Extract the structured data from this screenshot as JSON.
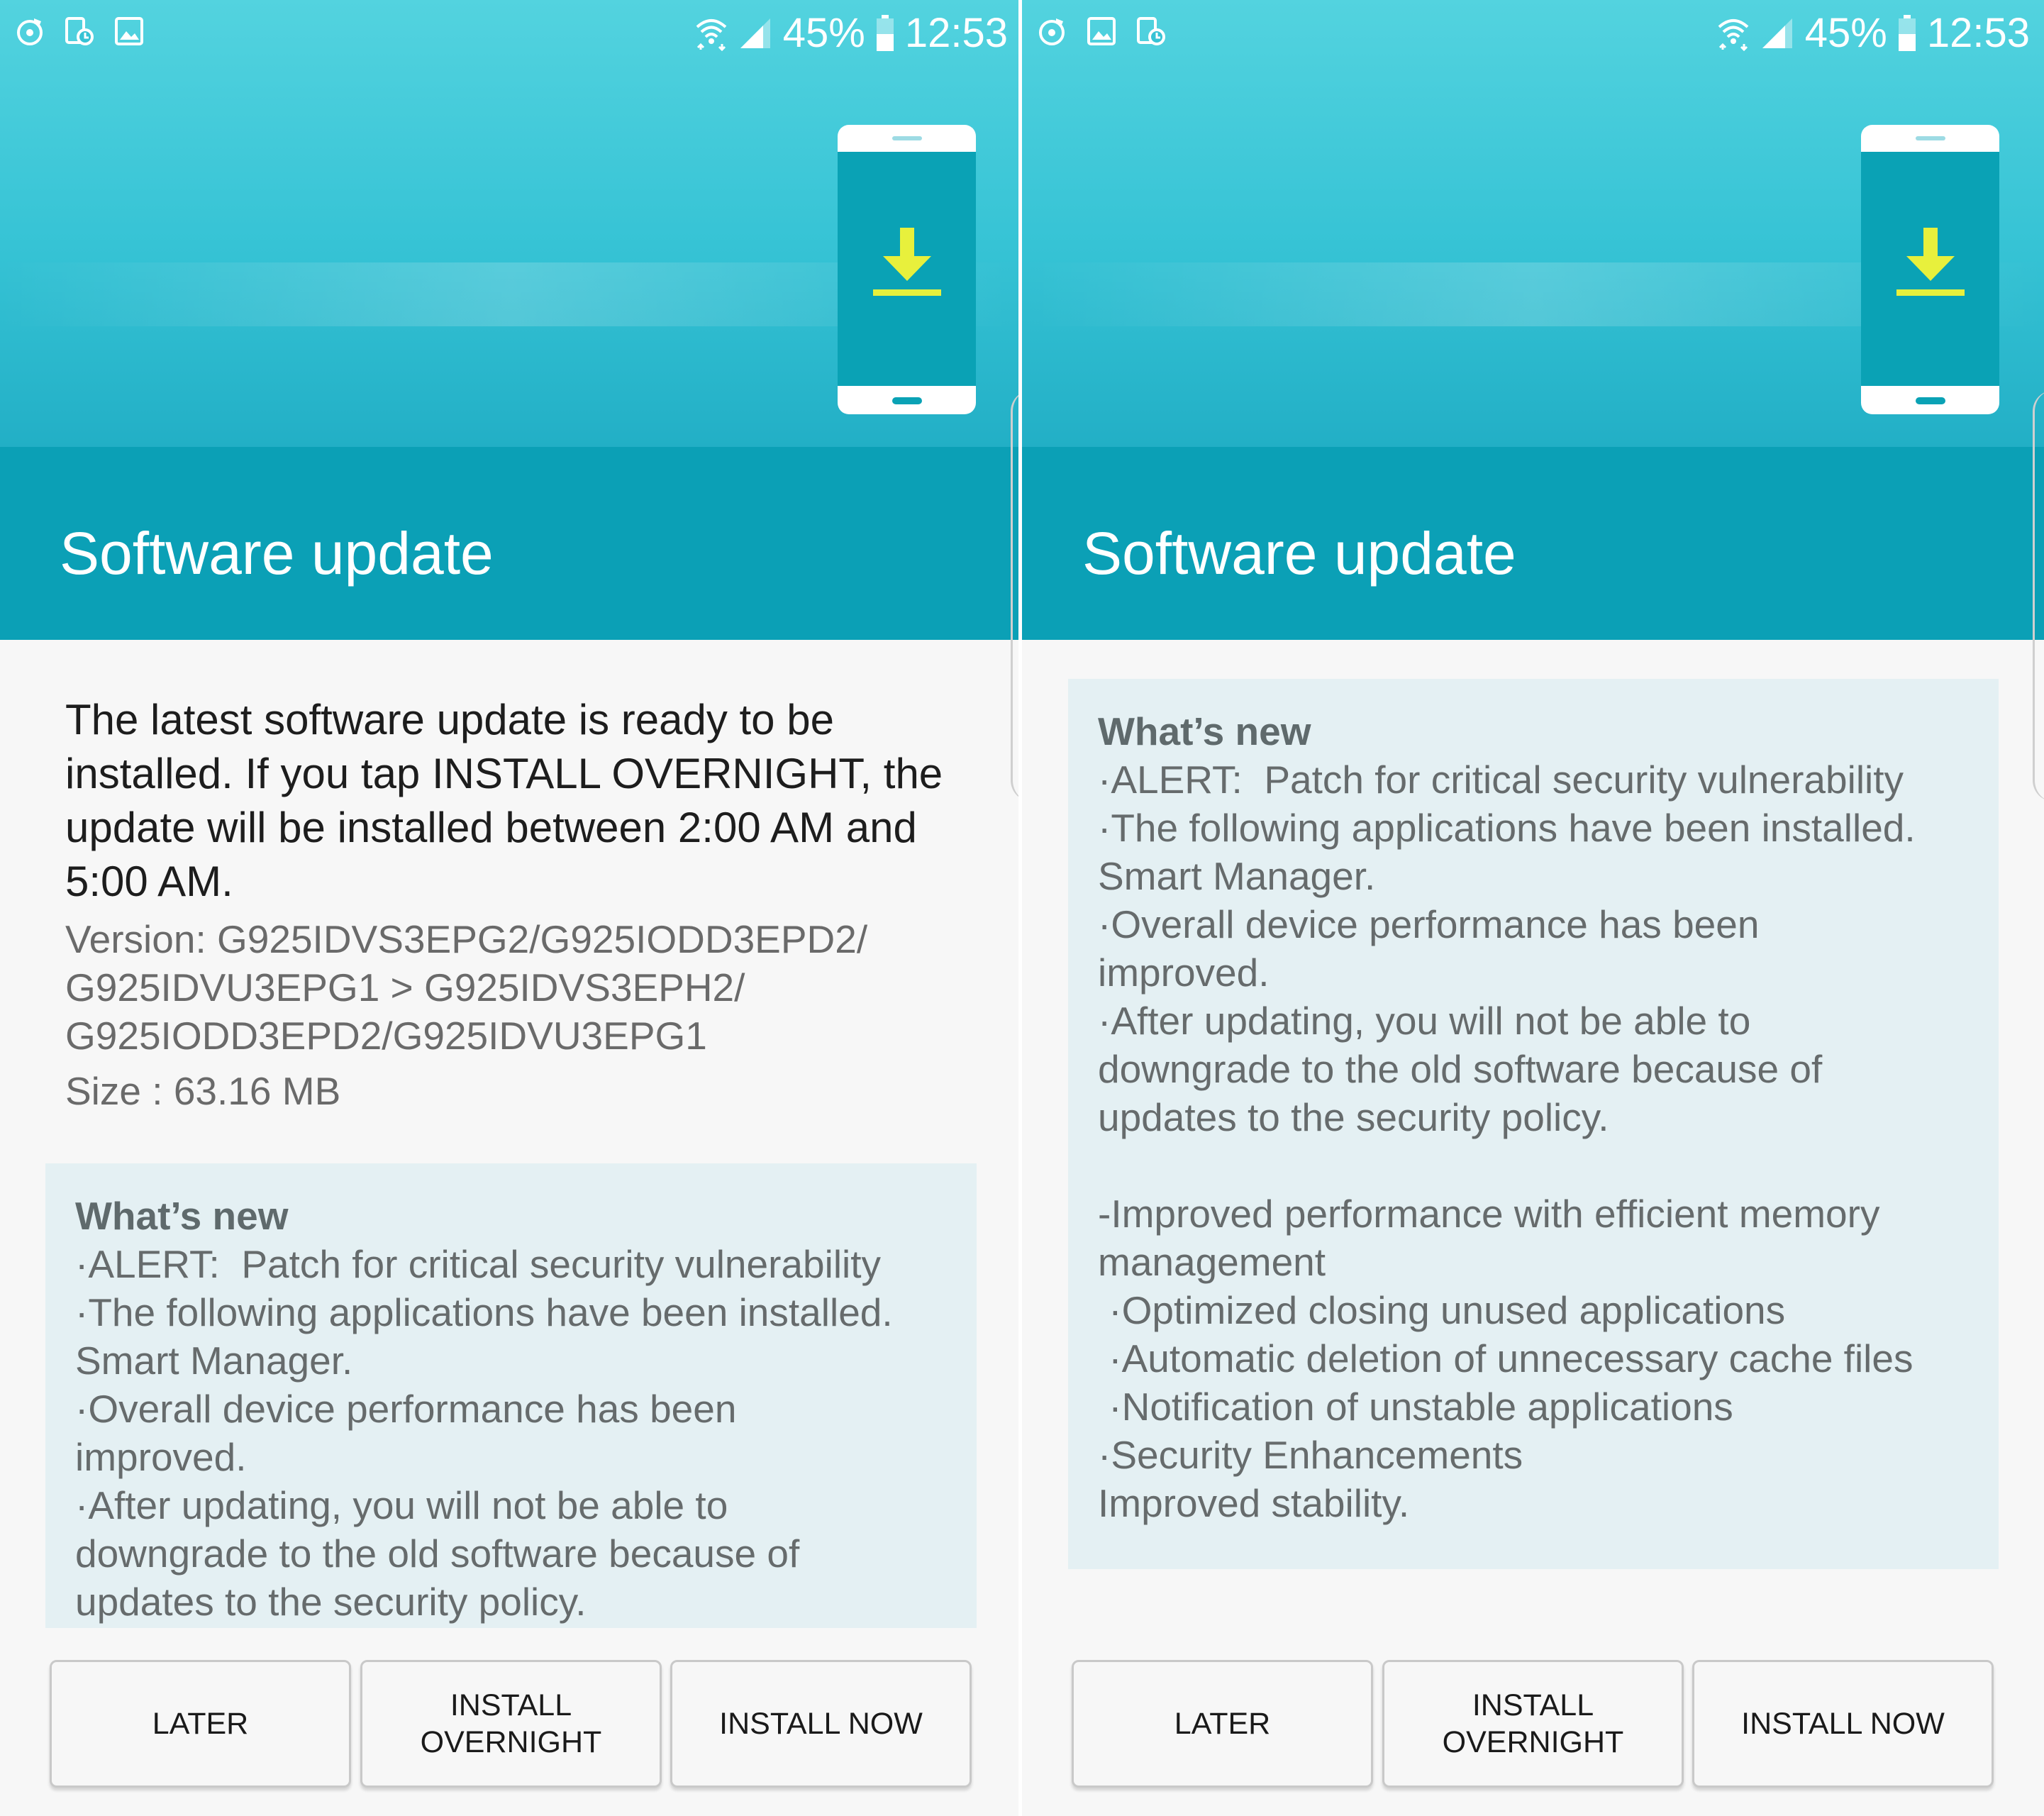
{
  "status_bar": {
    "battery": "45%",
    "time": "12:53",
    "left_icons": [
      "music-notification-icon",
      "screen-update-icon",
      "gallery-icon"
    ],
    "right_icons": [
      "wifi-icon",
      "signal-icon",
      "battery-icon"
    ]
  },
  "colors": {
    "hero_top": "#53d3df",
    "title_bar": "#0ba0b6",
    "download_arrow": "#e8f03c",
    "whats_new_bg": "#e4f0f3"
  },
  "screens": [
    {
      "title": "Software update",
      "intro": "The latest software update is ready to be installed. If you tap INSTALL OVERNIGHT, the update will be installed between 2:00 AM and 5:00 AM.",
      "version_lines": [
        "Version: G925IDVS3EPG2/G925IODD3EPD2/",
        "G925IDVU3EPG1 > G925IDVS3EPH2/",
        "G925IODD3EPD2/G925IDVU3EPG1"
      ],
      "size": "Size : 63.16 MB",
      "whats_new": {
        "title": "What’s new",
        "lines": [
          "·ALERT:  Patch for critical security vulnerability",
          "·The following applications have been installed.",
          "Smart Manager.",
          "·Overall device performance has been",
          "improved.",
          "·After updating, you will not be able to",
          "downgrade to the old software because of",
          "updates to the security policy."
        ]
      },
      "buttons": {
        "later": "LATER",
        "install_overnight": "INSTALL\nOVERNIGHT",
        "install_now": "INSTALL NOW"
      }
    },
    {
      "title": "Software update",
      "whats_new": {
        "title": "What’s new",
        "lines": [
          "·ALERT:  Patch for critical security vulnerability",
          "·The following applications have been installed.",
          "Smart Manager.",
          "·Overall device performance has been",
          "improved.",
          "·After updating, you will not be able to",
          "downgrade to the old software because of",
          "updates to the security policy.",
          "",
          "-Improved performance with efficient memory",
          "management",
          " ·Optimized closing unused applications",
          " ·Automatic deletion of unnecessary cache files",
          " ·Notification of unstable applications",
          "·Security Enhancements",
          "Improved stability."
        ]
      },
      "buttons": {
        "later": "LATER",
        "install_overnight": "INSTALL\nOVERNIGHT",
        "install_now": "INSTALL NOW"
      }
    }
  ]
}
